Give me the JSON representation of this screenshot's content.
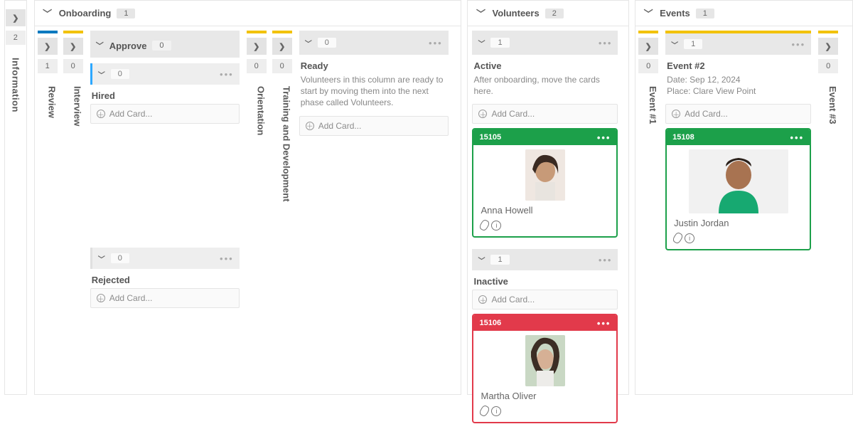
{
  "info_rail": {
    "count": "2",
    "label": "Information"
  },
  "onboarding": {
    "title": "Onboarding",
    "count": "1",
    "review": {
      "count": "1",
      "label": "Review"
    },
    "interview": {
      "count": "0",
      "label": "Interview"
    },
    "approve": {
      "title": "Approve",
      "count": "0",
      "hired": {
        "count": "0",
        "title": "Hired",
        "add": "Add Card..."
      },
      "rejected": {
        "count": "0",
        "title": "Rejected",
        "add": "Add Card..."
      }
    },
    "orientation": {
      "count": "0",
      "label": "Orientation"
    },
    "training": {
      "count": "0",
      "label": "Training and Development"
    },
    "ready": {
      "count": "0",
      "title": "Ready",
      "desc": "Volunteers in this column are ready to start by moving them into the next phase called Volunteers.",
      "add": "Add Card..."
    }
  },
  "volunteers": {
    "title": "Volunteers",
    "count": "2",
    "active": {
      "count": "1",
      "title": "Active",
      "desc": "After onboarding, move the cards here.",
      "add": "Add Card...",
      "card": {
        "id": "15105",
        "name": "Anna Howell"
      }
    },
    "inactive": {
      "count": "1",
      "title": "Inactive",
      "add": "Add Card...",
      "card": {
        "id": "15106",
        "name": "Martha Oliver"
      }
    }
  },
  "events": {
    "title": "Events",
    "count": "1",
    "event1": {
      "count": "0",
      "label": "Event #1"
    },
    "event2": {
      "count": "1",
      "title": "Event #2",
      "line1": "Date: Sep 12, 2024",
      "line2": "Place: Clare View Point",
      "add": "Add Card...",
      "card": {
        "id": "15108",
        "name": "Justin Jordan"
      }
    },
    "event3": {
      "count": "0",
      "label": "Event #3"
    }
  }
}
